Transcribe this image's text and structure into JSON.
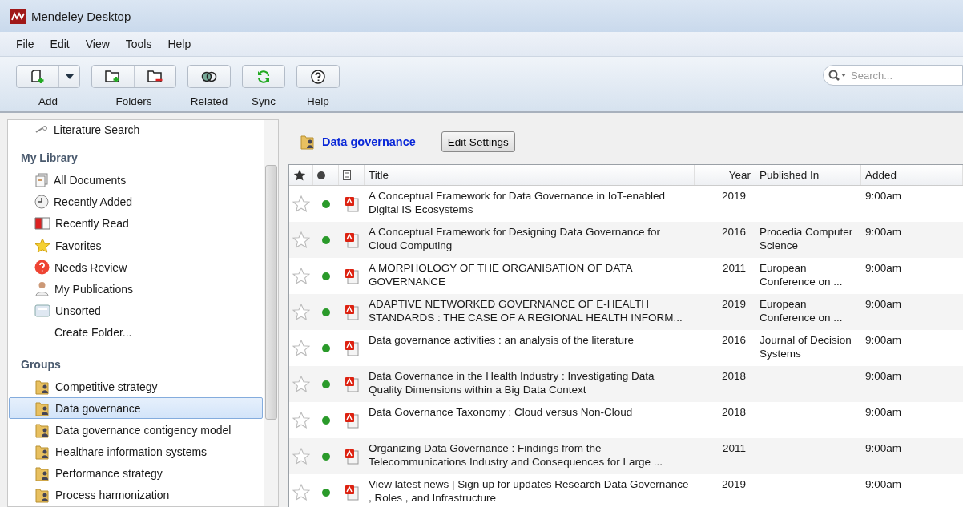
{
  "window": {
    "title": "Mendeley Desktop"
  },
  "menu": [
    "File",
    "Edit",
    "View",
    "Tools",
    "Help"
  ],
  "toolbar": [
    {
      "label": "Add"
    },
    {
      "label": "Folders"
    },
    {
      "label": "Related"
    },
    {
      "label": "Sync"
    },
    {
      "label": "Help"
    }
  ],
  "search": {
    "placeholder": "Search..."
  },
  "sidebar": {
    "top_item": {
      "label": "Literature Search"
    },
    "sections": [
      {
        "title": "My Library",
        "items": [
          {
            "label": "All Documents",
            "selected": false
          },
          {
            "label": "Recently Added",
            "selected": false
          },
          {
            "label": "Recently Read",
            "selected": false
          },
          {
            "label": "Favorites",
            "selected": false
          },
          {
            "label": "Needs Review",
            "selected": false
          },
          {
            "label": "My Publications",
            "selected": false
          },
          {
            "label": "Unsorted",
            "selected": false
          },
          {
            "label": "Create Folder...",
            "selected": false
          }
        ]
      },
      {
        "title": "Groups",
        "items": [
          {
            "label": "Competitive strategy",
            "selected": false
          },
          {
            "label": "Data governance",
            "selected": true
          },
          {
            "label": "Data governance contigency model",
            "selected": false
          },
          {
            "label": "Healthare information systems",
            "selected": false
          },
          {
            "label": "Performance strategy",
            "selected": false
          },
          {
            "label": "Process harmonization",
            "selected": false
          }
        ]
      }
    ]
  },
  "group_header": {
    "title": "Data governance",
    "button": "Edit Settings"
  },
  "table": {
    "columns": [
      "Title",
      "Year",
      "Published In",
      "Added"
    ],
    "rows": [
      {
        "favorite": false,
        "unread": true,
        "title": "A Conceptual Framework for Data Governance in IoT-enabled Digital IS Ecosystems",
        "year": "2019",
        "published_in": "",
        "added": "9:00am"
      },
      {
        "favorite": false,
        "unread": true,
        "title": "A Conceptual Framework for Designing Data Governance for Cloud Computing",
        "year": "2016",
        "published_in": "Procedia Computer Science",
        "added": "9:00am"
      },
      {
        "favorite": false,
        "unread": true,
        "title": "A MORPHOLOGY OF THE ORGANISATION OF DATA GOVERNANCE",
        "year": "2011",
        "published_in": "European Conference on ...",
        "added": "9:00am"
      },
      {
        "favorite": false,
        "unread": true,
        "title": "ADAPTIVE NETWORKED GOVERNANCE OF E-HEALTH STANDARDS : THE CASE OF A REGIONAL HEALTH INFORM...",
        "year": "2019",
        "published_in": "European Conference on ...",
        "added": "9:00am"
      },
      {
        "favorite": false,
        "unread": true,
        "title": "Data governance activities : an analysis of the literature",
        "year": "2016",
        "published_in": "Journal of Decision Systems",
        "added": "9:00am"
      },
      {
        "favorite": false,
        "unread": true,
        "title": "Data Governance in the Health Industry : Investigating Data Quality Dimensions within a Big Data Context",
        "year": "2018",
        "published_in": "",
        "added": "9:00am"
      },
      {
        "favorite": false,
        "unread": true,
        "title": "Data Governance Taxonomy : Cloud versus Non-Cloud",
        "year": "2018",
        "published_in": "",
        "added": "9:00am"
      },
      {
        "favorite": false,
        "unread": true,
        "title": "Organizing Data Governance : Findings from the Telecommunications Industry and Consequences for Large ...",
        "year": "2011",
        "published_in": "",
        "added": "9:00am"
      },
      {
        "favorite": false,
        "unread": true,
        "title": "View latest news | Sign up for updates Research Data Governance , Roles , and Infrastructure",
        "year": "2019",
        "published_in": "",
        "added": "9:00am"
      }
    ]
  }
}
